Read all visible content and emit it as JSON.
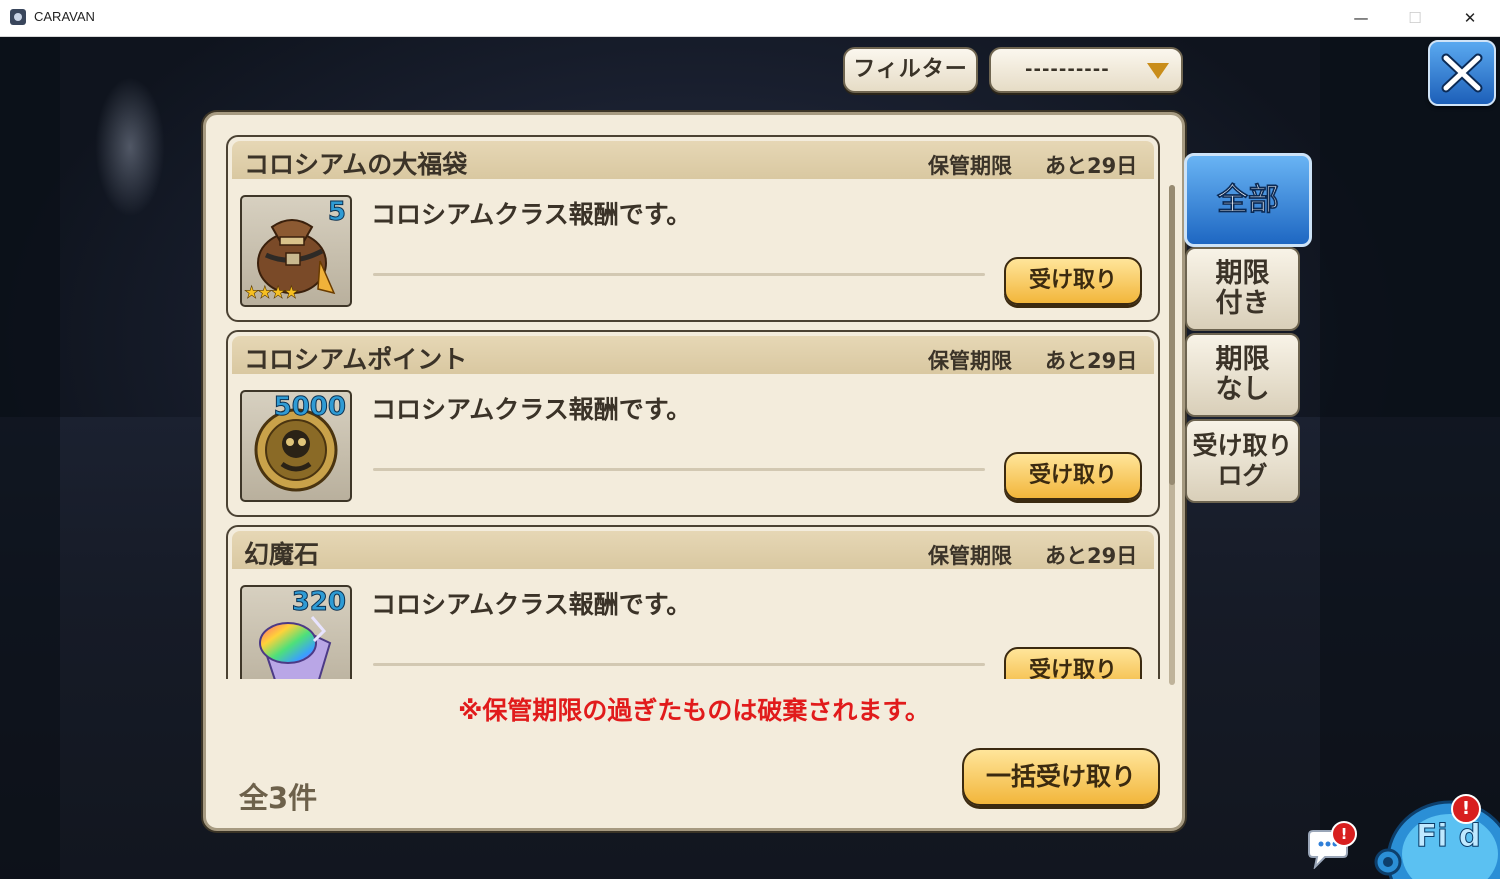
{
  "window": {
    "title": "CARAVAN",
    "minimize_glyph": "—",
    "maximize_glyph": "☐",
    "close_glyph": "✕"
  },
  "filter": {
    "button_label": "フィルター",
    "selected_value": "----------"
  },
  "tabs": [
    {
      "label_lines": [
        "全部"
      ],
      "active": true
    },
    {
      "label_lines": [
        "期限",
        "付き"
      ],
      "active": false
    },
    {
      "label_lines": [
        "期限",
        "なし"
      ],
      "active": false
    },
    {
      "label_lines": [
        "受け取り",
        "ログ"
      ],
      "active": false
    }
  ],
  "items": [
    {
      "title": "コロシアムの大福袋",
      "expiry_label": "保管期限",
      "expiry_value": "あと29日",
      "count": "5",
      "stars": "★★★★",
      "description": "コロシアムクラス報酬です。",
      "claim_label": "受け取り",
      "icon": "reward-bag-icon"
    },
    {
      "title": "コロシアムポイント",
      "expiry_label": "保管期限",
      "expiry_value": "あと29日",
      "count": "5000",
      "description": "コロシアムクラス報酬です。",
      "claim_label": "受け取り",
      "icon": "colosseum-coin-icon"
    },
    {
      "title": "幻魔石",
      "expiry_label": "保管期限",
      "expiry_value": "あと29日",
      "count": "320",
      "description": "コロシアムクラス報酬です。",
      "claim_label": "受け取り",
      "icon": "rainbow-crystal-icon"
    }
  ],
  "footer": {
    "warning": "※保管期限の過ぎたものは破棄されます。",
    "total": "全3件",
    "claim_all_label": "一括受け取り"
  },
  "widgets": {
    "chat_badge": "!",
    "mascot_label": "Fi d",
    "mascot_badge": "!"
  },
  "colors": {
    "accent_blue": "#1e67c2",
    "button_gold": "#f2b63b",
    "warning_red": "#e11b1b",
    "panel_bg": "#f3ecdc"
  }
}
